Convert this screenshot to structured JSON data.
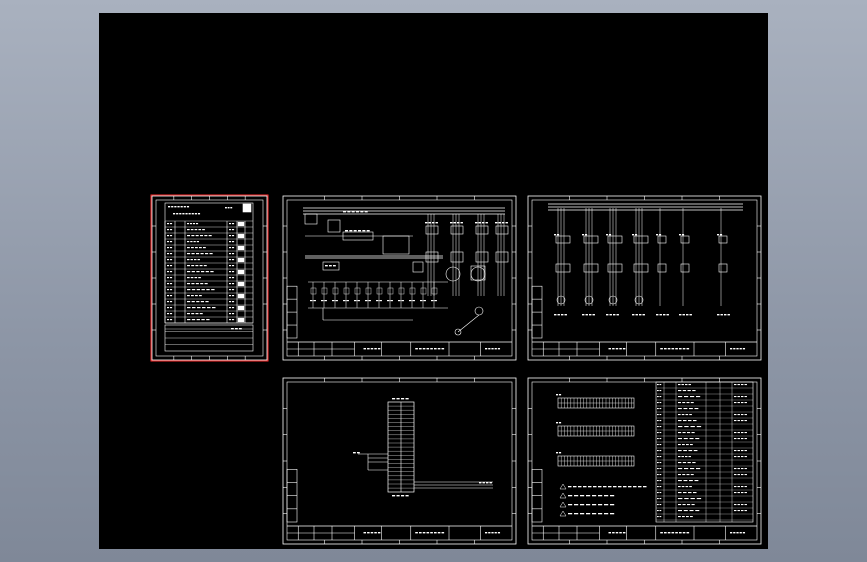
{
  "app": {
    "name": "",
    "colors": {
      "background_top": "#a9b1bf",
      "background_bottom": "#7f8898",
      "model_space": "#000000",
      "linework": "#ffffff",
      "selection": "#ff2a2a"
    }
  },
  "sheets": [
    {
      "id": "sheet-1",
      "kind": "bill-of-materials",
      "selected": true
    },
    {
      "id": "sheet-2",
      "kind": "power-circuit-schematic",
      "selected": false
    },
    {
      "id": "sheet-3",
      "kind": "branch-circuit-schematic",
      "selected": false
    },
    {
      "id": "sheet-4",
      "kind": "plc-io-wiring",
      "selected": false
    },
    {
      "id": "sheet-5",
      "kind": "terminal-layout-and-notes",
      "selected": false
    }
  ]
}
